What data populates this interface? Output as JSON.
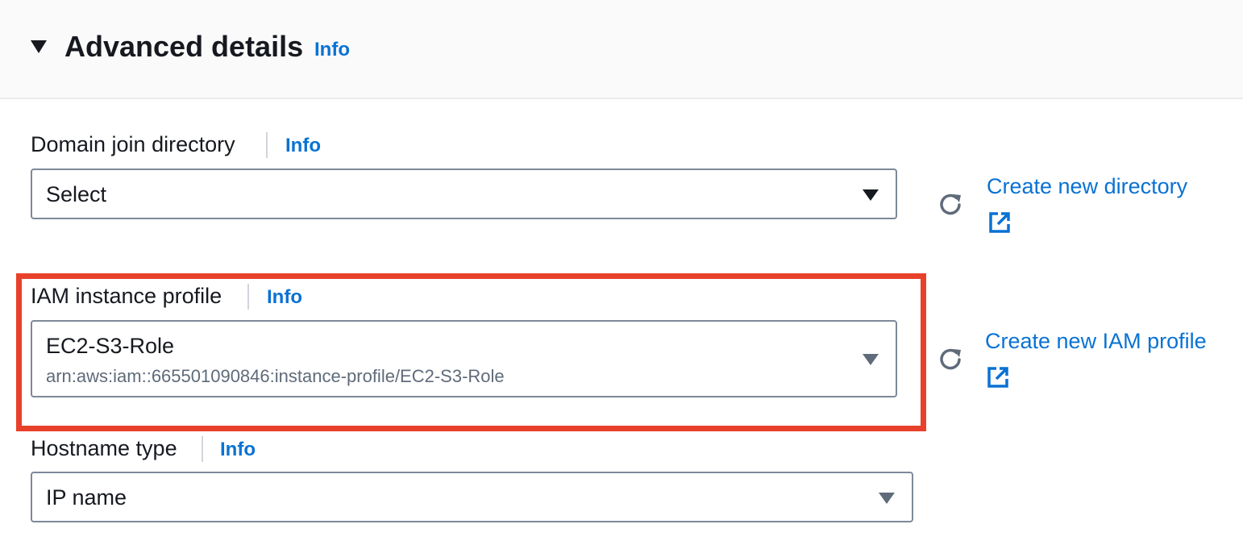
{
  "header": {
    "title": "Advanced details",
    "info_label": "Info",
    "expanded": true
  },
  "fields": {
    "domain_join": {
      "label": "Domain join directory",
      "info_label": "Info",
      "value": "Select",
      "create_link": "Create new directory"
    },
    "iam_profile": {
      "label": "IAM instance profile",
      "info_label": "Info",
      "value": "EC2-S3-Role",
      "value_description": "arn:aws:iam::665501090846:instance-profile/EC2-S3-Role",
      "create_link": "Create new IAM profile"
    },
    "hostname_type": {
      "label": "Hostname type",
      "info_label": "Info",
      "value": "IP name"
    }
  },
  "icons": {
    "toggle": "caret-down-filled-icon",
    "select_caret": "caret-down-icon",
    "refresh": "refresh-icon",
    "external": "external-link-icon"
  },
  "colors": {
    "link": "#0972d3",
    "text": "#16191f",
    "secondary_text": "#5f6b7a",
    "border": "#7d8998",
    "header_bg": "#fafafa",
    "highlight": "#e8412b"
  }
}
